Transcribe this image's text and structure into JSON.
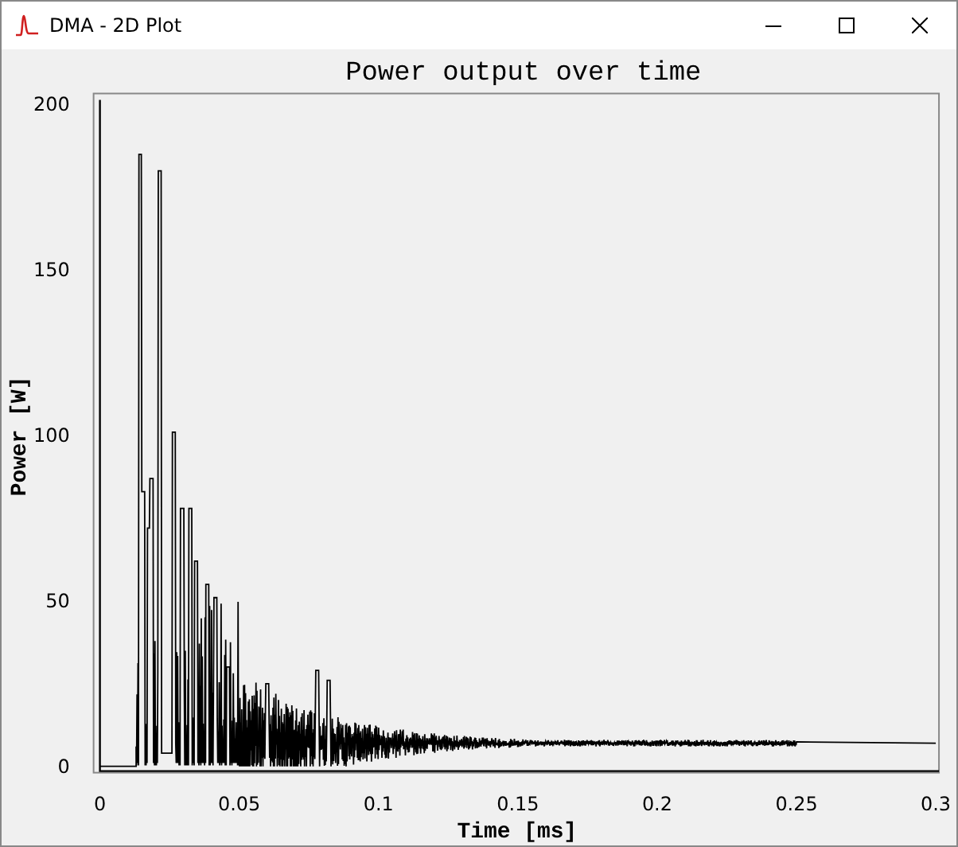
{
  "window": {
    "title": "DMA - 2D Plot"
  },
  "plot": {
    "title": "Power output over time",
    "xlabel": "Time [ms]",
    "ylabel": "Power [W]",
    "xticks": [
      "0",
      "0.05",
      "0.1",
      "0.15",
      "0.2",
      "0.25",
      "0.3"
    ],
    "yticks": [
      "200",
      "150",
      "100",
      "50",
      "0"
    ]
  }
}
